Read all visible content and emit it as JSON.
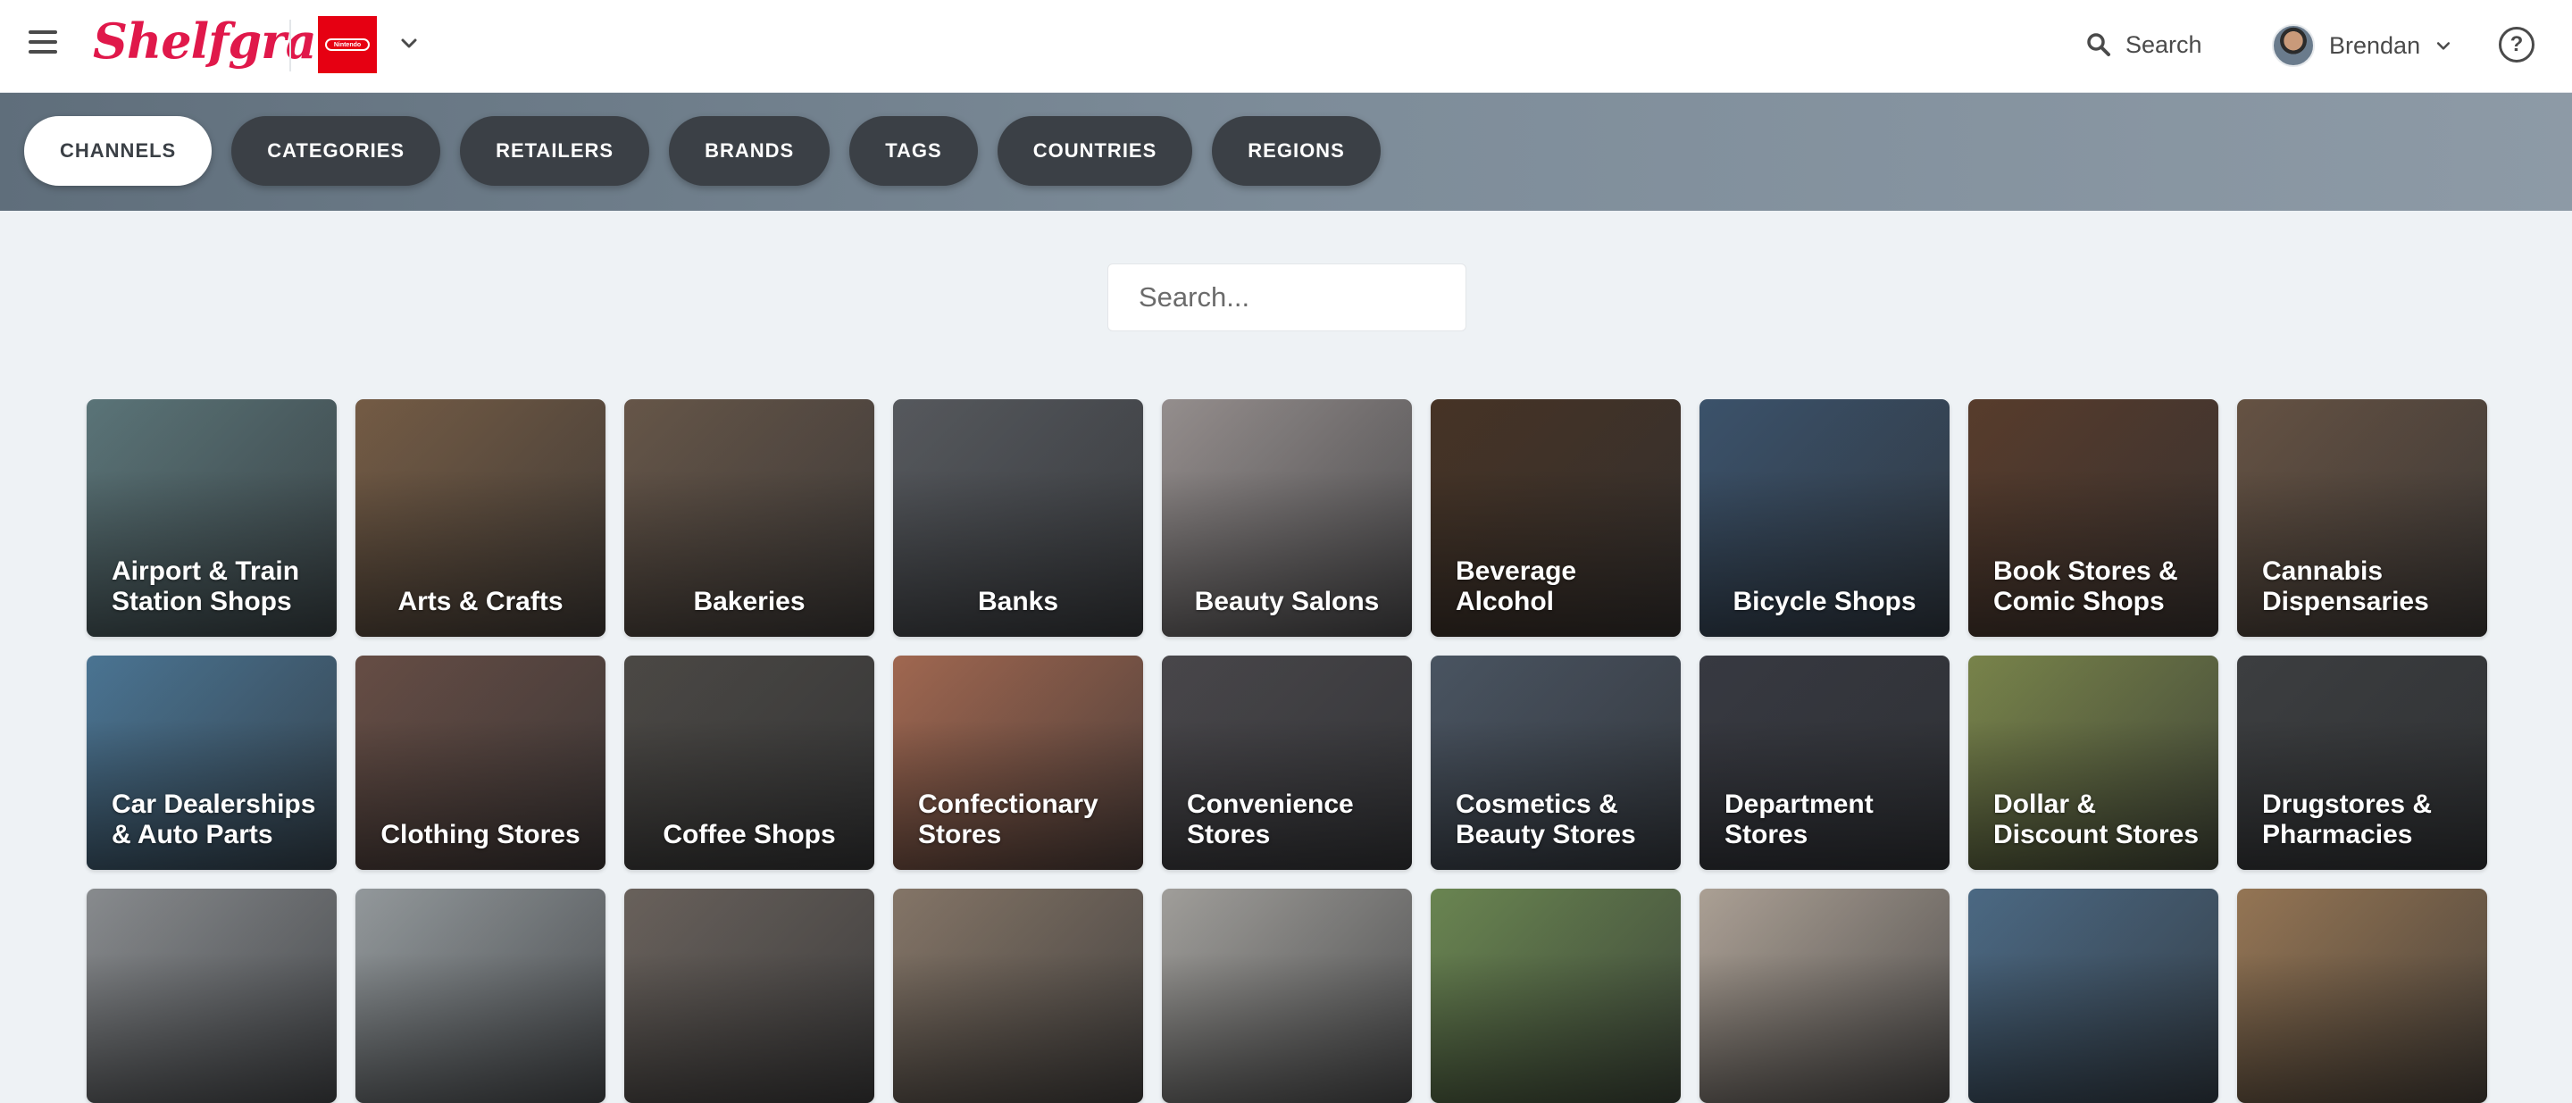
{
  "header": {
    "logo_text": "Shelfgram",
    "brand_chip_text": "Nintendo",
    "search_label": "Search",
    "user_name": "Brendan",
    "help_symbol": "?"
  },
  "filters": [
    {
      "label": "CHANNELS",
      "active": true
    },
    {
      "label": "CATEGORIES",
      "active": false
    },
    {
      "label": "RETAILERS",
      "active": false
    },
    {
      "label": "BRANDS",
      "active": false
    },
    {
      "label": "TAGS",
      "active": false
    },
    {
      "label": "COUNTRIES",
      "active": false
    },
    {
      "label": "REGIONS",
      "active": false
    }
  ],
  "search": {
    "placeholder": "Search..."
  },
  "channels": [
    {
      "label": "Airport & Train Station Shops",
      "bg": "#5f7a7e"
    },
    {
      "label": "Arts & Crafts",
      "bg": "#7a6048",
      "center": true
    },
    {
      "label": "Bakeries",
      "bg": "#6b5a4c",
      "center": true
    },
    {
      "label": "Banks",
      "bg": "#5a5d62",
      "center": true
    },
    {
      "label": "Beauty Salons",
      "bg": "#9c9594",
      "center": true
    },
    {
      "label": "Beverage Alcohol",
      "bg": "#4a3627"
    },
    {
      "label": "Bicycle Shops",
      "bg": "#3e5670",
      "center": true
    },
    {
      "label": "Book Stores & Comic Shops",
      "bg": "#5c3f2e"
    },
    {
      "label": "Cannabis Dispensaries",
      "bg": "#6a5646"
    },
    {
      "label": "Car Dealerships & Auto Parts",
      "bg": "#4e7a9a"
    },
    {
      "label": "Clothing Stores",
      "bg": "#6b5148",
      "center": true
    },
    {
      "label": "Coffee Shops",
      "bg": "#4f4c48",
      "center": true
    },
    {
      "label": "Confectionary Stores",
      "bg": "#a86c54"
    },
    {
      "label": "Convenience Stores",
      "bg": "#4c4a4e"
    },
    {
      "label": "Cosmetics & Beauty Stores",
      "bg": "#4d5866"
    },
    {
      "label": "Department Stores",
      "bg": "#3a3c44"
    },
    {
      "label": "Dollar & Discount Stores",
      "bg": "#7e8a4e"
    },
    {
      "label": "Drugstores & Pharmacies",
      "bg": "#3f4143"
    },
    {
      "label": "",
      "bg": "#8f9295"
    },
    {
      "label": "",
      "bg": "#9aa0a3"
    },
    {
      "label": "",
      "bg": "#6e6660"
    },
    {
      "label": "",
      "bg": "#8b7b6c"
    },
    {
      "label": "",
      "bg": "#a8a6a2"
    },
    {
      "label": "",
      "bg": "#6f8c55"
    },
    {
      "label": "",
      "bg": "#b4a89c"
    },
    {
      "label": "",
      "bg": "#4f6e8a"
    },
    {
      "label": "",
      "bg": "#9c7b58"
    }
  ]
}
